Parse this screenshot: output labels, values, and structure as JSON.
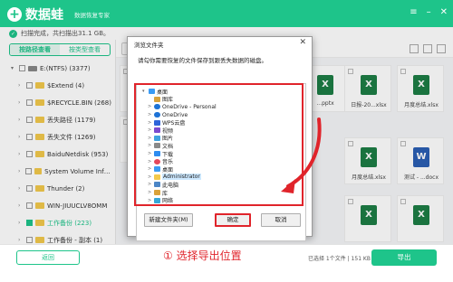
{
  "app": {
    "name": "数据蛙",
    "subtitle": "数据恢复专家",
    "window_controls": [
      "menu-icon",
      "minimize-icon",
      "close-icon"
    ]
  },
  "status": {
    "text": "扫描完成，共扫描出31.1 GB。"
  },
  "left": {
    "tabs": [
      {
        "label": "按路径查看",
        "active": true
      },
      {
        "label": "按类型查看",
        "active": false
      }
    ],
    "tree": [
      {
        "label": "E:(NTFS) (3377)",
        "level": 0,
        "icon": "drive-icon",
        "expanded": true
      },
      {
        "label": "$Extend (4)",
        "level": 1,
        "icon": "folder-icon"
      },
      {
        "label": "$RECYCLE.BIN (268)",
        "level": 1,
        "icon": "folder-icon"
      },
      {
        "label": "丢失路径 (1179)",
        "level": 1,
        "icon": "folder-icon"
      },
      {
        "label": "丢失文件 (1269)",
        "level": 1,
        "icon": "folder-icon"
      },
      {
        "label": "BaiduNetdisk (953)",
        "level": 1,
        "icon": "folder-icon"
      },
      {
        "label": "System Volume Informat",
        "level": 1,
        "icon": "folder-icon"
      },
      {
        "label": "Thunder (2)",
        "level": 1,
        "icon": "folder-icon"
      },
      {
        "label": "WIN-JIUUCLV8OMM",
        "level": 1,
        "icon": "folder-icon"
      },
      {
        "label": "工作备份 (223)",
        "level": 1,
        "icon": "folder-icon",
        "selected": true
      },
      {
        "label": "工作备份 - 副本 (1)",
        "level": 1,
        "icon": "folder-icon"
      }
    ]
  },
  "files": [
    {
      "name": "",
      "type": "xlsx"
    },
    {
      "name": "",
      "type": "xlsx"
    },
    {
      "name": "...pptx",
      "type": "xlsx"
    },
    {
      "name": "日报-20...xlsx",
      "type": "xlsx"
    },
    {
      "name": "月度总结.xlsx",
      "type": "xlsx"
    },
    {
      "name": "",
      "type": "xlsx"
    },
    {
      "name": "月度总结.xlsx",
      "type": "xlsx"
    },
    {
      "name": "测试 - ...docx",
      "type": "docx"
    },
    {
      "name": "",
      "type": "xlsx"
    },
    {
      "name": "",
      "type": "xlsx"
    }
  ],
  "dialog": {
    "title": "浏览文件夹",
    "prompt": "请勾你需要恢复的文件保存到跟丢失数据的磁盘。",
    "tree": [
      {
        "label": "桌面",
        "icon": "desktop-icon",
        "level": 0,
        "arrow": "▾"
      },
      {
        "label": "图库",
        "icon": "library-icon",
        "level": 1,
        "arrow": ""
      },
      {
        "label": "OneDrive - Personal",
        "icon": "cloud-icon",
        "level": 1,
        "arrow": ">"
      },
      {
        "label": "OneDrive",
        "icon": "cloud-icon",
        "level": 1,
        "arrow": ">"
      },
      {
        "label": "WPS云盘",
        "icon": "wps-icon",
        "level": 1,
        "arrow": ">"
      },
      {
        "label": "视频",
        "icon": "video-icon",
        "level": 1,
        "arrow": ">"
      },
      {
        "label": "图片",
        "icon": "picture-icon",
        "level": 1,
        "arrow": ">"
      },
      {
        "label": "文档",
        "icon": "document-icon",
        "level": 1,
        "arrow": ">"
      },
      {
        "label": "下载",
        "icon": "download-icon",
        "level": 1,
        "arrow": ">"
      },
      {
        "label": "音乐",
        "icon": "music-icon",
        "level": 1,
        "arrow": ">"
      },
      {
        "label": "桌面",
        "icon": "desktop-icon",
        "level": 1,
        "arrow": ">"
      },
      {
        "label": "Administrator",
        "icon": "user-folder-icon",
        "level": 1,
        "arrow": ">",
        "highlight": true
      },
      {
        "label": "此电脑",
        "icon": "computer-icon",
        "level": 1,
        "arrow": ">"
      },
      {
        "label": "库",
        "icon": "library-icon",
        "level": 1,
        "arrow": ">"
      },
      {
        "label": "网络",
        "icon": "network-icon",
        "level": 1,
        "arrow": ">"
      }
    ],
    "buttons": {
      "new_folder": "新建文件夹(M)",
      "ok": "确定",
      "cancel": "取消"
    }
  },
  "bottom": {
    "back_label": "返回",
    "hint": "① 选择导出位置",
    "selection_info": "已选择 1个文件 | 151 KB",
    "export_label": "导出"
  },
  "colors": {
    "brand": "#1ec48a",
    "annotation": "#e0242b"
  }
}
